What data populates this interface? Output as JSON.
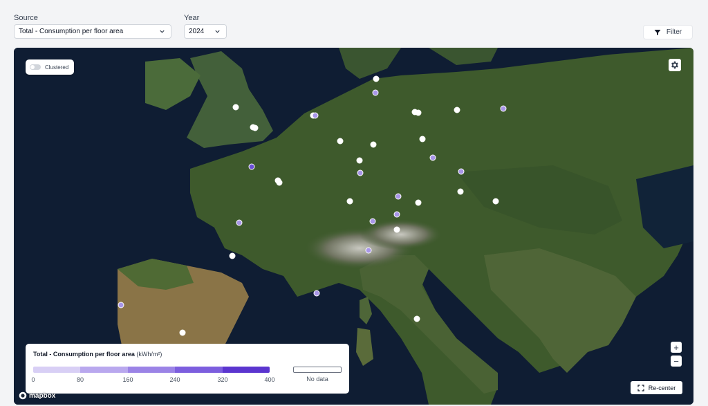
{
  "filters": {
    "source_label": "Source",
    "source_value": "Total - Consumption per floor area",
    "year_label": "Year",
    "year_value": "2024",
    "filter_button": "Filter"
  },
  "map": {
    "clustered_toggle": {
      "label": "Clustered",
      "on": false
    },
    "zoom_in": "+",
    "zoom_out": "−",
    "recenter_label": "Re-center",
    "attribution_logo": "mapbox",
    "colors": {
      "marker_white": "#ffffff",
      "marker_purple": "#a896e8",
      "marker_dark_purple": "#6b4fd8"
    }
  },
  "legend": {
    "title": "Total - Consumption per floor area",
    "unit": "(kWh/m²)",
    "ticks": [
      "0",
      "80",
      "160",
      "240",
      "320",
      "400"
    ],
    "colors": [
      "#d8cff5",
      "#b9a8ee",
      "#9b83e6",
      "#7c5ede",
      "#5b35cf"
    ],
    "no_data_label": "No data"
  }
}
